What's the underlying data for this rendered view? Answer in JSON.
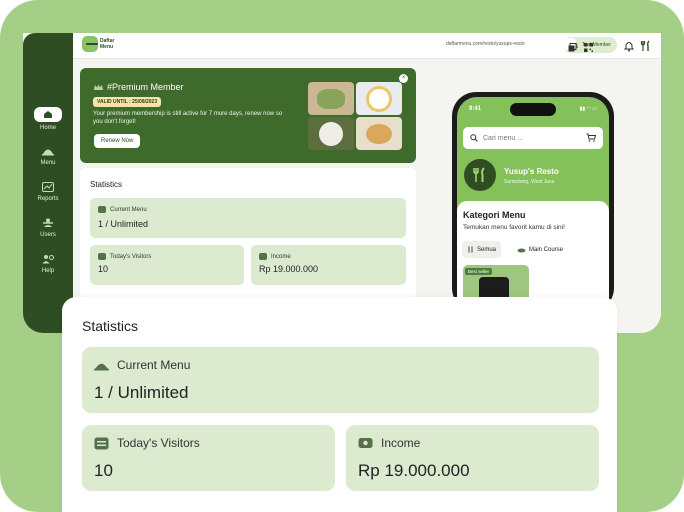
{
  "brand": {
    "line1": "Daftar",
    "line2": "Menu"
  },
  "sidebar": {
    "items": [
      {
        "label": "Home"
      },
      {
        "label": "Menu"
      },
      {
        "label": "Reports"
      },
      {
        "label": "Users"
      },
      {
        "label": "Help"
      }
    ]
  },
  "topbar": {
    "trial_label": "Trial Member"
  },
  "banner": {
    "title": "#Premium Member",
    "valid": "VALID UNTIL : 25/08/2023",
    "desc": "Your premium membership is still active for 7 more days, renew now so you don't forget!",
    "renew_label": "Renew Now"
  },
  "statistics": {
    "title": "Statistics",
    "current_menu": {
      "label": "Current Menu",
      "value": "1 / Unlimited"
    },
    "visitors": {
      "label": "Today's Visitors",
      "value": "10"
    },
    "income": {
      "label": "Income",
      "value": "Rp 19.000.000"
    }
  },
  "preview": {
    "url": "daftarmenu.com/resto/yusups-resto",
    "time": "9:41",
    "search_placeholder": "Cari menu ...",
    "resto_name": "Yusup's Resto",
    "resto_location": "Sumedang, West Java",
    "kategori_title": "Kategori Menu",
    "kategori_sub": "Temukan menu favorit kamu di sini!",
    "chips": [
      {
        "label": "Semua"
      },
      {
        "label": "Main Course"
      }
    ],
    "best_seller": "Best seller"
  },
  "colors": {
    "sidebar": "#2f4d22",
    "banner": "#3e6a2c",
    "card": "#dcebd0",
    "outer_bg": "#a5cf86"
  }
}
